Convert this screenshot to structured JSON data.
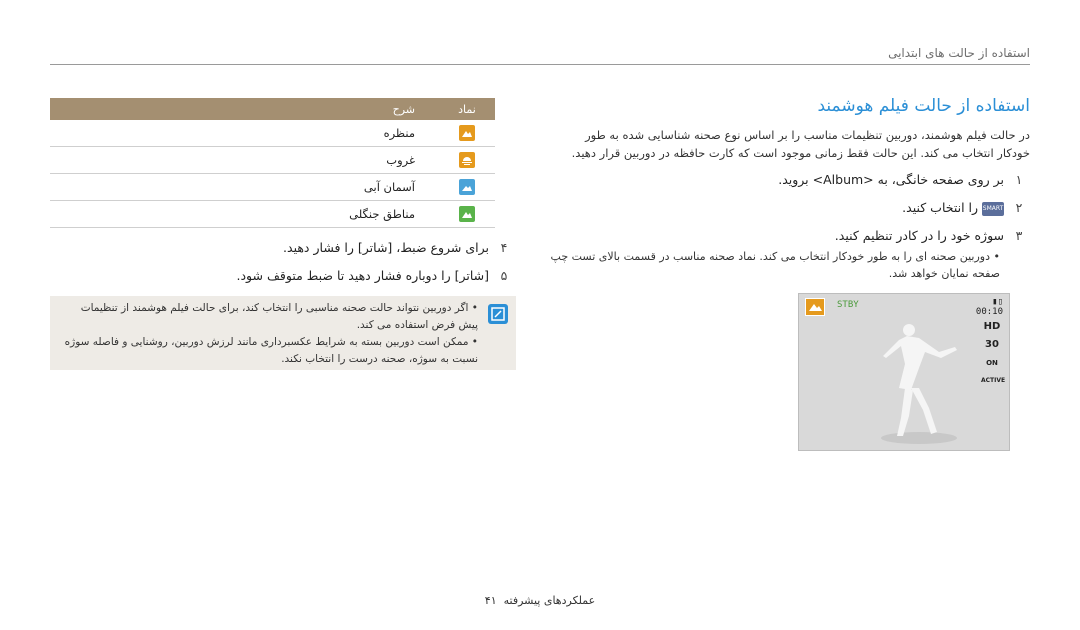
{
  "header": {
    "text": "استفاده از حالت های ابتدایی"
  },
  "section": {
    "title": "استفاده از حالت فیلم هوشمند",
    "intro": "در حالت فیلم هوشمند، دوربین تنظیمات مناسب را بر اساس نوع صحنه شناسایی شده به طور خودکار انتخاب می کند. این حالت فقط زمانی موجود است که کارت حافظه در دوربین قرار دهید."
  },
  "steps": [
    {
      "num": "۱",
      "text": "بر روی صفحه خانگی، به <Album> بروید."
    },
    {
      "num": "۲",
      "text": "را انتخاب کنید."
    },
    {
      "num": "۳",
      "text": "سوژه خود را در کادر تنظیم کنید."
    },
    {
      "num": "۴",
      "text": "برای شروع ضبط، [شاتر] را فشار دهید."
    },
    {
      "num": "۵",
      "text": "[شاتر] را دوباره فشار دهید تا ضبط متوقف شود."
    }
  ],
  "step2_icon": "SMART",
  "step3_bullet": "دوربین صحنه ای را به طور خودکار انتخاب می کند. نماد صحنه مناسب در قسمت بالای تست چپ صفحه نمایان خواهد شد.",
  "lcd": {
    "status": "STBY",
    "battery": "▮▯",
    "time": "00:10",
    "icons": [
      "HD",
      "30",
      "ON",
      "ACTIVE"
    ]
  },
  "table": {
    "headers": {
      "icon": "نماد",
      "desc": "شرح"
    },
    "rows": [
      {
        "icon": "landscape-icon",
        "color": "#e59a1d",
        "label": "منظره"
      },
      {
        "icon": "sunset-icon",
        "color": "#e59a1d",
        "label": "غروب"
      },
      {
        "icon": "blue-sky-icon",
        "color": "#4aa3d8",
        "label": "آسمان آبی"
      },
      {
        "icon": "forest-icon",
        "color": "#5ab34a",
        "label": "مناطق جنگلی"
      }
    ]
  },
  "note": {
    "items": [
      "اگر دوربین نتواند حالت صحنه مناسبی را انتخاب کند، برای حالت فیلم هوشمند از تنظیمات پیش فرض استفاده می کند.",
      "ممکن است دوربین بسته به شرایط عکسبرداری مانند لرزش دوربین، روشنایی و فاصله سوژه نسبت به سوژه، صحنه درست را انتخاب نکند."
    ]
  },
  "footer": {
    "page": "۴۱",
    "label": "عملکردهای پیشرفته"
  }
}
